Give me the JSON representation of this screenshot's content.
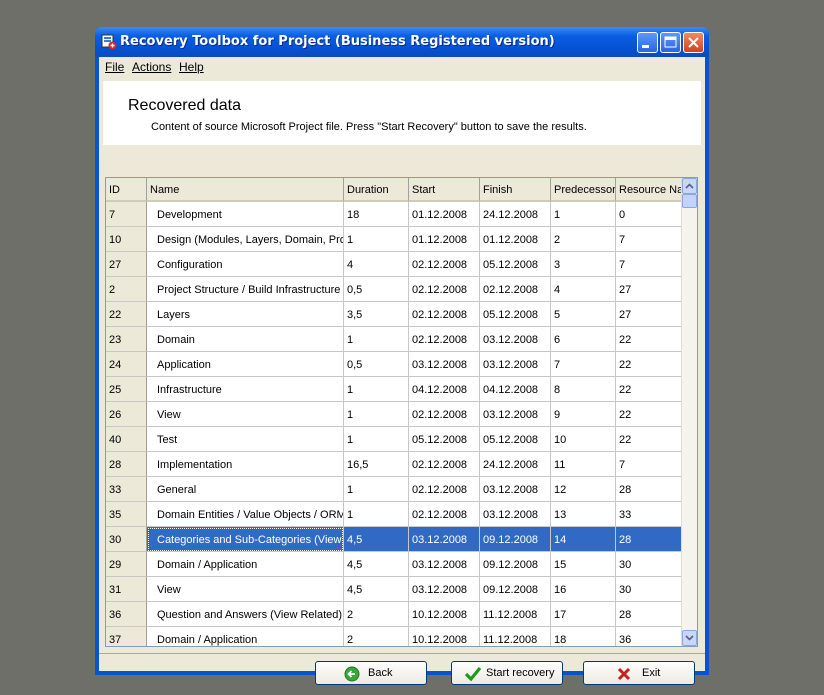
{
  "window": {
    "title": "Recovery Toolbox for Project (Business Registered version)",
    "controls": [
      "minimize-icon",
      "maximize-icon",
      "close-icon"
    ]
  },
  "menu": {
    "file": "File",
    "actions": "Actions",
    "help": "Help"
  },
  "header": {
    "title": "Recovered data",
    "subtitle": "Content of source Microsoft Project file. Press \"Start Recovery\" button to save the results."
  },
  "table": {
    "columns": [
      "ID",
      "Name",
      "Duration",
      "Start",
      "Finish",
      "Predecessors",
      "Resource Names"
    ],
    "selected_row_index": 13,
    "rows": [
      [
        "7",
        "Development",
        "18",
        "01.12.2008",
        "24.12.2008",
        "1",
        "0"
      ],
      [
        "10",
        "Design (Modules, Layers, Domain, Project Structure)",
        "1",
        "01.12.2008",
        "01.12.2008",
        "2",
        "7"
      ],
      [
        "27",
        "Configuration",
        "4",
        "02.12.2008",
        "05.12.2008",
        "3",
        "7"
      ],
      [
        "2",
        "Project Structure / Build Infrastructure",
        "0,5",
        "02.12.2008",
        "02.12.2008",
        "4",
        "27"
      ],
      [
        "22",
        "Layers",
        "3,5",
        "02.12.2008",
        "05.12.2008",
        "5",
        "27"
      ],
      [
        "23",
        "Domain",
        "1",
        "02.12.2008",
        "03.12.2008",
        "6",
        "22"
      ],
      [
        "24",
        "Application",
        "0,5",
        "03.12.2008",
        "03.12.2008",
        "7",
        "22"
      ],
      [
        "25",
        "Infrastructure",
        "1",
        "04.12.2008",
        "04.12.2008",
        "8",
        "22"
      ],
      [
        "26",
        "View",
        "1",
        "02.12.2008",
        "03.12.2008",
        "9",
        "22"
      ],
      [
        "40",
        "Test",
        "1",
        "05.12.2008",
        "05.12.2008",
        "10",
        "22"
      ],
      [
        "28",
        "Implementation",
        "16,5",
        "02.12.2008",
        "24.12.2008",
        "11",
        "7"
      ],
      [
        "33",
        "General",
        "1",
        "02.12.2008",
        "03.12.2008",
        "12",
        "28"
      ],
      [
        "35",
        "Domain Entities / Value Objects / ORM Mapping",
        "1",
        "02.12.2008",
        "03.12.2008",
        "13",
        "33"
      ],
      [
        "30",
        "Categories and Sub-Categories (View Related)",
        "4,5",
        "03.12.2008",
        "09.12.2008",
        "14",
        "28"
      ],
      [
        "29",
        "Domain / Application",
        "4,5",
        "03.12.2008",
        "09.12.2008",
        "15",
        "30"
      ],
      [
        "31",
        "View",
        "4,5",
        "03.12.2008",
        "09.12.2008",
        "16",
        "30"
      ],
      [
        "36",
        "Question and Answers (View Related)",
        "2",
        "10.12.2008",
        "11.12.2008",
        "17",
        "28"
      ],
      [
        "37",
        "Domain / Application",
        "2",
        "10.12.2008",
        "11.12.2008",
        "18",
        "36"
      ]
    ]
  },
  "buttons": {
    "back": "Back",
    "start": "Start recovery",
    "exit": "Exit"
  },
  "colors": {
    "title_bar": "#0a5ee2",
    "selection": "#316ac5",
    "face": "#ece9d8"
  }
}
